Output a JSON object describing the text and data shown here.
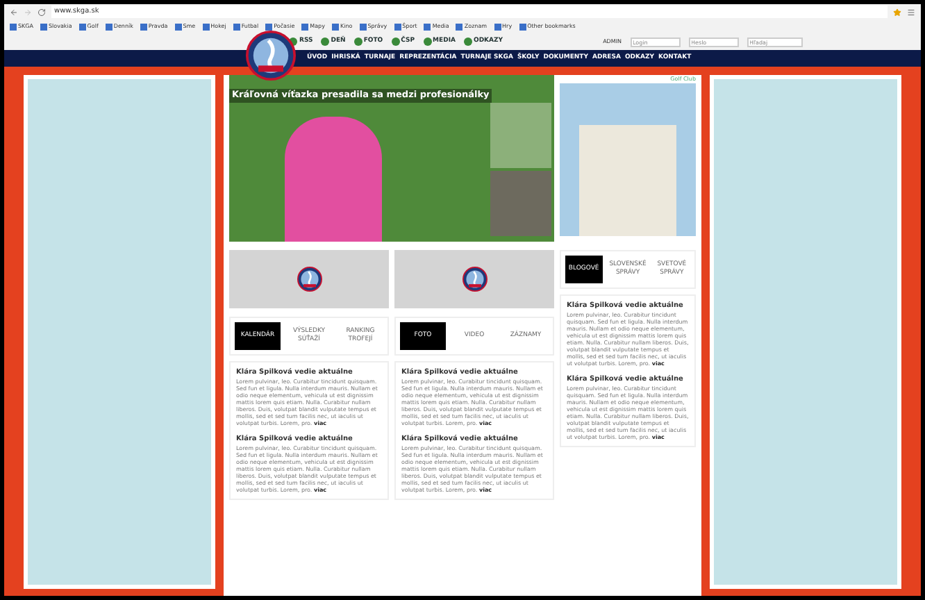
{
  "browser": {
    "url": "www.skga.sk",
    "bookmarks": [
      "SKGA",
      "Slovakia",
      "Golf",
      "Denník",
      "Pravda",
      "Sme",
      "Hokej",
      "Futbal",
      "Počasie",
      "Mapy",
      "Kino",
      "Správy",
      "Šport",
      "Media",
      "Zoznam",
      "Hry",
      "Other bookmarks"
    ]
  },
  "topbar": {
    "links": [
      "RSS",
      "DEŇ",
      "FOTO",
      "ČSP",
      "MEDIA",
      "ODKAZY"
    ],
    "login_label": "ADMIN",
    "username_placeholder": "Login",
    "password_placeholder": "Heslo",
    "search_placeholder": "Hľadaj"
  },
  "nav": [
    "ÚVOD",
    "IHRISKÁ",
    "TURNAJE",
    "REPREZENTÁCIA",
    "TURNAJE SKGA",
    "ŠKOLY",
    "DOKUMENTY",
    "ADRESA",
    "ODKAZY",
    "KONTAKT"
  ],
  "hero": {
    "headline": "Kráľovná víťazka presadila sa medzi profesionálky",
    "caption": "Golf Club"
  },
  "columns": [
    {
      "tabs": [
        {
          "label": "KALENDÁR",
          "selected": true
        },
        {
          "label": "VÝSLEDKY SÚŤAŽÍ",
          "selected": false
        },
        {
          "label": "RANKING TROFEJÍ",
          "selected": false
        }
      ],
      "articles": [
        {
          "title": "Klára Spilková vedie aktuálne",
          "body": "Lorem pulvinar, leo. Curabitur tincidunt quisquam. Sed fun et ligula. Nulla interdum mauris. Nullam et odio neque elementum, vehicula ut est dignissim mattis lorem quis etiam. Nulla. Curabitur nullam liberos. Duis, volutpat blandit vulputate tempus et mollis, sed et sed tum facilis nec, ut iaculis ut volutpat turbis. Lorem, pro.",
          "more": "viac"
        },
        {
          "title": "Klára Spilková vedie aktuálne",
          "body": "Lorem pulvinar, leo. Curabitur tincidunt quisquam. Sed fun et ligula. Nulla interdum mauris. Nullam et odio neque elementum, vehicula ut est dignissim mattis lorem quis etiam. Nulla. Curabitur nullam liberos. Duis, volutpat blandit vulputate tempus et mollis, sed et sed tum facilis nec, ut iaculis ut volutpat turbis. Lorem, pro.",
          "more": "viac"
        }
      ]
    },
    {
      "tabs": [
        {
          "label": "FOTO",
          "selected": true
        },
        {
          "label": "VIDEO",
          "selected": false
        },
        {
          "label": "ZÁZNAMY",
          "selected": false
        }
      ],
      "articles": [
        {
          "title": "Klára Spilková vedie aktuálne",
          "body": "Lorem pulvinar, leo. Curabitur tincidunt quisquam. Sed fun et ligula. Nulla interdum mauris. Nullam et odio neque elementum, vehicula ut est dignissim mattis lorem quis etiam. Nulla. Curabitur nullam liberos. Duis, volutpat blandit vulputate tempus et mollis, sed et sed tum facilis nec, ut iaculis ut volutpat turbis. Lorem, pro.",
          "more": "viac"
        },
        {
          "title": "Klára Spilková vedie aktuálne",
          "body": "Lorem pulvinar, leo. Curabitur tincidunt quisquam. Sed fun et ligula. Nulla interdum mauris. Nullam et odio neque elementum, vehicula ut est dignissim mattis lorem quis etiam. Nulla. Curabitur nullam liberos. Duis, volutpat blandit vulputate tempus et mollis, sed et sed tum facilis nec, ut iaculis ut volutpat turbis. Lorem, pro.",
          "more": "viac"
        }
      ]
    },
    {
      "tabs": [
        {
          "label": "BLOGOVÉ",
          "selected": true
        },
        {
          "label": "SLOVENSKÉ SPRÁVY",
          "selected": false
        },
        {
          "label": "SVETOVÉ SPRÁVY",
          "selected": false
        }
      ],
      "articles": [
        {
          "title": "Klára Spilková vedie aktuálne",
          "body": "Lorem pulvinar, leo. Curabitur tincidunt quisquam. Sed fun et ligula. Nulla interdum mauris. Nullam et odio neque elementum, vehicula ut est dignissim mattis lorem quis etiam. Nulla. Curabitur nullam liberos. Duis, volutpat blandit vulputate tempus et mollis, sed et sed tum facilis nec, ut iaculis ut volutpat turbis. Lorem, pro.",
          "more": "viac"
        },
        {
          "title": "Klára Spilková vedie aktuálne",
          "body": "Lorem pulvinar, leo. Curabitur tincidunt quisquam. Sed fun et ligula. Nulla interdum mauris. Nullam et odio neque elementum, vehicula ut est dignissim mattis lorem quis etiam. Nulla. Curabitur nullam liberos. Duis, volutpat blandit vulputate tempus et mollis, sed et sed tum facilis nec, ut iaculis ut volutpat turbis. Lorem, pro.",
          "more": "viac"
        }
      ]
    }
  ]
}
